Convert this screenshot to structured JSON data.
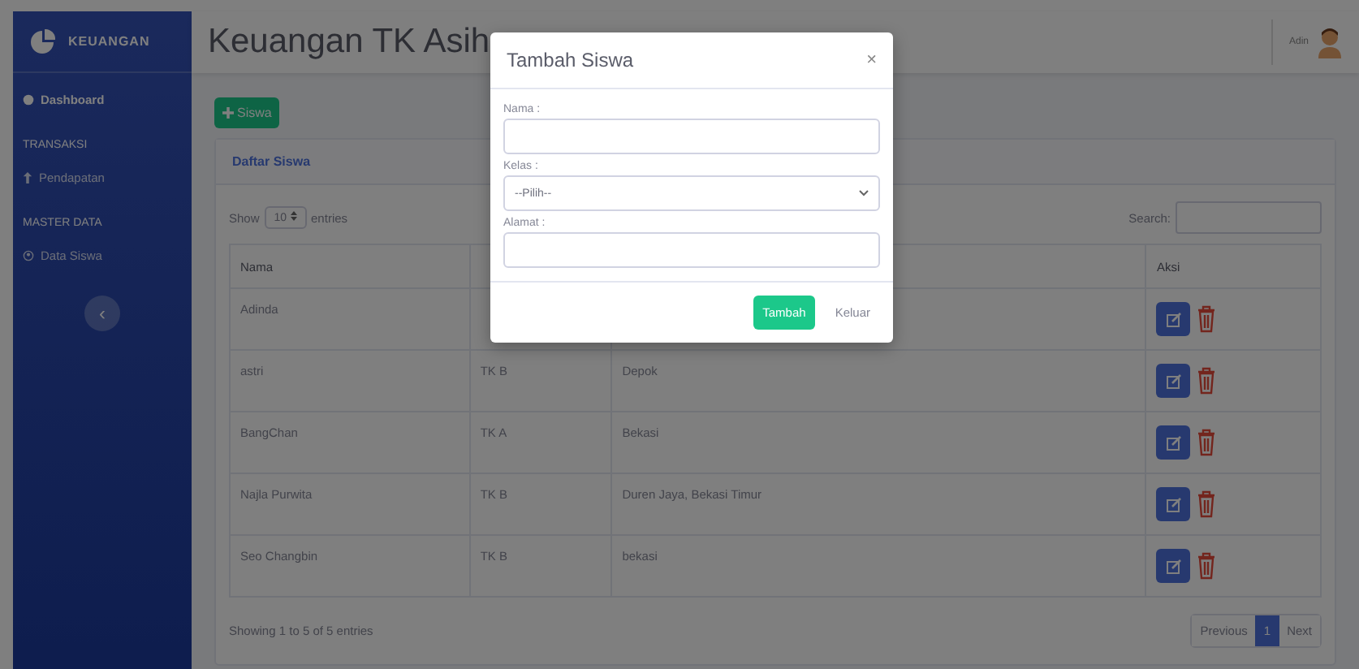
{
  "sidebar": {
    "brand": "KEUANGAN",
    "items": [
      {
        "kind": "link",
        "label": "Dashboard",
        "selected": true
      },
      {
        "kind": "heading",
        "label": "TRANSAKSI"
      },
      {
        "kind": "link",
        "label": "Pendapatan",
        "selected": false
      },
      {
        "kind": "heading",
        "label": "MASTER DATA"
      },
      {
        "kind": "link",
        "label": "Data Siswa",
        "selected": false
      }
    ],
    "toggle": "‹"
  },
  "header": {
    "title": "Keuangan TK Asih",
    "user": "Adin"
  },
  "add_button": "Siswa",
  "card": {
    "title": "Daftar Siswa",
    "show_label": "Show",
    "page_size": "10",
    "entries_label": "entries",
    "search_label": "Search:",
    "columns": [
      {
        "label": "Nama"
      },
      {},
      {},
      {
        "label": "Aksi"
      }
    ],
    "rows": [
      {
        "nama": "Adinda"
      },
      {
        "nama": "astri",
        "kelas": "TK B",
        "alamat": "Depok"
      },
      {
        "nama": "BangChan",
        "kelas": "TK A",
        "alamat": "Bekasi"
      },
      {
        "nama": "Najla Purwita",
        "kelas": "TK B",
        "alamat": "Duren Jaya, Bekasi Timur"
      },
      {
        "nama": "Seo Changbin",
        "kelas": "TK B",
        "alamat": "bekasi"
      }
    ],
    "info": "Showing 1 to 5 of 5 entries",
    "pagination": [
      {
        "label": "Previous",
        "selected": false
      },
      {
        "label": "1",
        "selected": true
      },
      {
        "label": "Next",
        "selected": false
      }
    ]
  },
  "modal": {
    "title": "Tambah Siswa",
    "close": "×",
    "fields": [
      {
        "kind": "text",
        "label": "Nama :"
      },
      {
        "kind": "select",
        "label": "Kelas :",
        "value": "--Pilih--"
      },
      {
        "kind": "text",
        "label": "Alamat :"
      }
    ],
    "buttons": [
      {
        "kind": "primary",
        "label": "Tambah"
      },
      {
        "kind": "link",
        "label": "Keluar"
      }
    ]
  }
}
